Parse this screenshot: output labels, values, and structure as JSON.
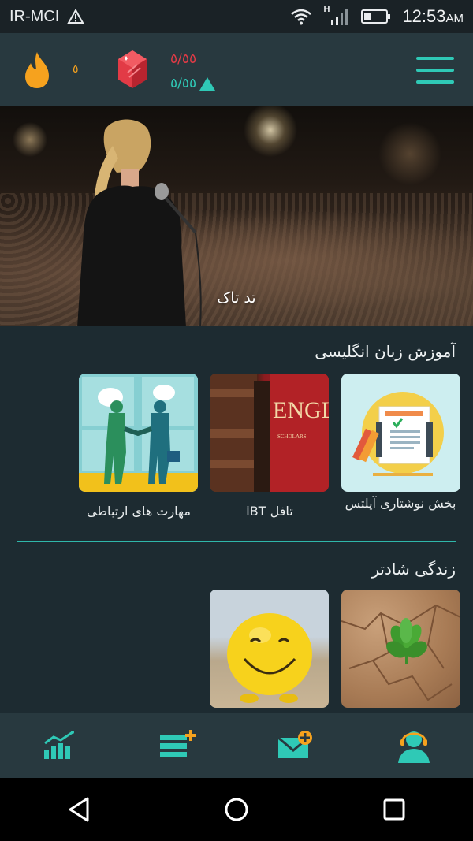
{
  "status_bar": {
    "carrier": "IR-MCI",
    "network_type": "H",
    "time": "12:53",
    "ampm": "AM"
  },
  "header": {
    "flame_count": "٥",
    "stat_red": "٥/٥٥",
    "stat_teal": "٥/٥٥",
    "accent_color": "#2fc9b6",
    "flame_color": "#f6a21e",
    "gem_color": "#e23b46"
  },
  "banner": {
    "title": "تد تاک"
  },
  "sections": [
    {
      "title": "آموزش زبان انگلیسی",
      "cards": [
        {
          "label": "بخش نوشتاری آیلتس",
          "icon": "ielts-writing-image"
        },
        {
          "label": "تافل iBT",
          "icon": "english-book-image"
        },
        {
          "label": "مهارت های ارتباطی",
          "icon": "communication-skills-image"
        }
      ]
    },
    {
      "title": "زندگی شادتر",
      "cards": [
        {
          "label": "",
          "icon": "plant-in-cracked-ground-image"
        },
        {
          "label": "",
          "icon": "smiley-ball-image"
        }
      ]
    }
  ],
  "bottom_nav": [
    {
      "name": "stats-icon"
    },
    {
      "name": "add-list-icon"
    },
    {
      "name": "add-message-icon"
    },
    {
      "name": "support-agent-icon"
    }
  ],
  "system_nav": [
    "back-icon",
    "home-icon",
    "recents-icon"
  ]
}
